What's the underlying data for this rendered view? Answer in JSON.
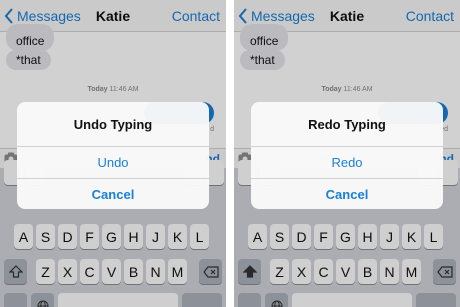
{
  "left": {
    "nav": {
      "back_label": "Messages",
      "title": "Katie",
      "contact_label": "Contact"
    },
    "messages": {
      "bubble1": "office",
      "bubble2": "*that",
      "timestamp_day": "Today",
      "timestamp_time": "11:46 AM",
      "delivered_fragment": "d"
    },
    "compose": {
      "send_fragment": "nd"
    },
    "alert": {
      "title": "Undo Typing",
      "action_label": "Undo",
      "cancel_label": "Cancel"
    }
  },
  "right": {
    "nav": {
      "back_label": "Messages",
      "title": "Katie",
      "contact_label": "Contact"
    },
    "messages": {
      "bubble1": "office",
      "bubble2": "*that",
      "timestamp_day": "Today",
      "timestamp_time": "11:46 AM",
      "delivered_fragment": "ed"
    },
    "compose": {
      "send_fragment": "nd"
    },
    "alert": {
      "title": "Redo Typing",
      "action_label": "Redo",
      "cancel_label": "Cancel"
    }
  },
  "keyboard": {
    "row2": [
      "A",
      "S",
      "D",
      "F",
      "G",
      "H",
      "J",
      "K",
      "L"
    ],
    "row3": [
      "Z",
      "X",
      "C",
      "V",
      "B",
      "N",
      "M"
    ],
    "shift_icon": "shift-icon",
    "delete_icon": "delete-icon",
    "globe_icon": "globe-icon"
  },
  "colors": {
    "ios_blue": "#1a7fd6",
    "incoming_bubble": "#e5e5ea",
    "keyboard_bg": "#d1d4d9"
  }
}
